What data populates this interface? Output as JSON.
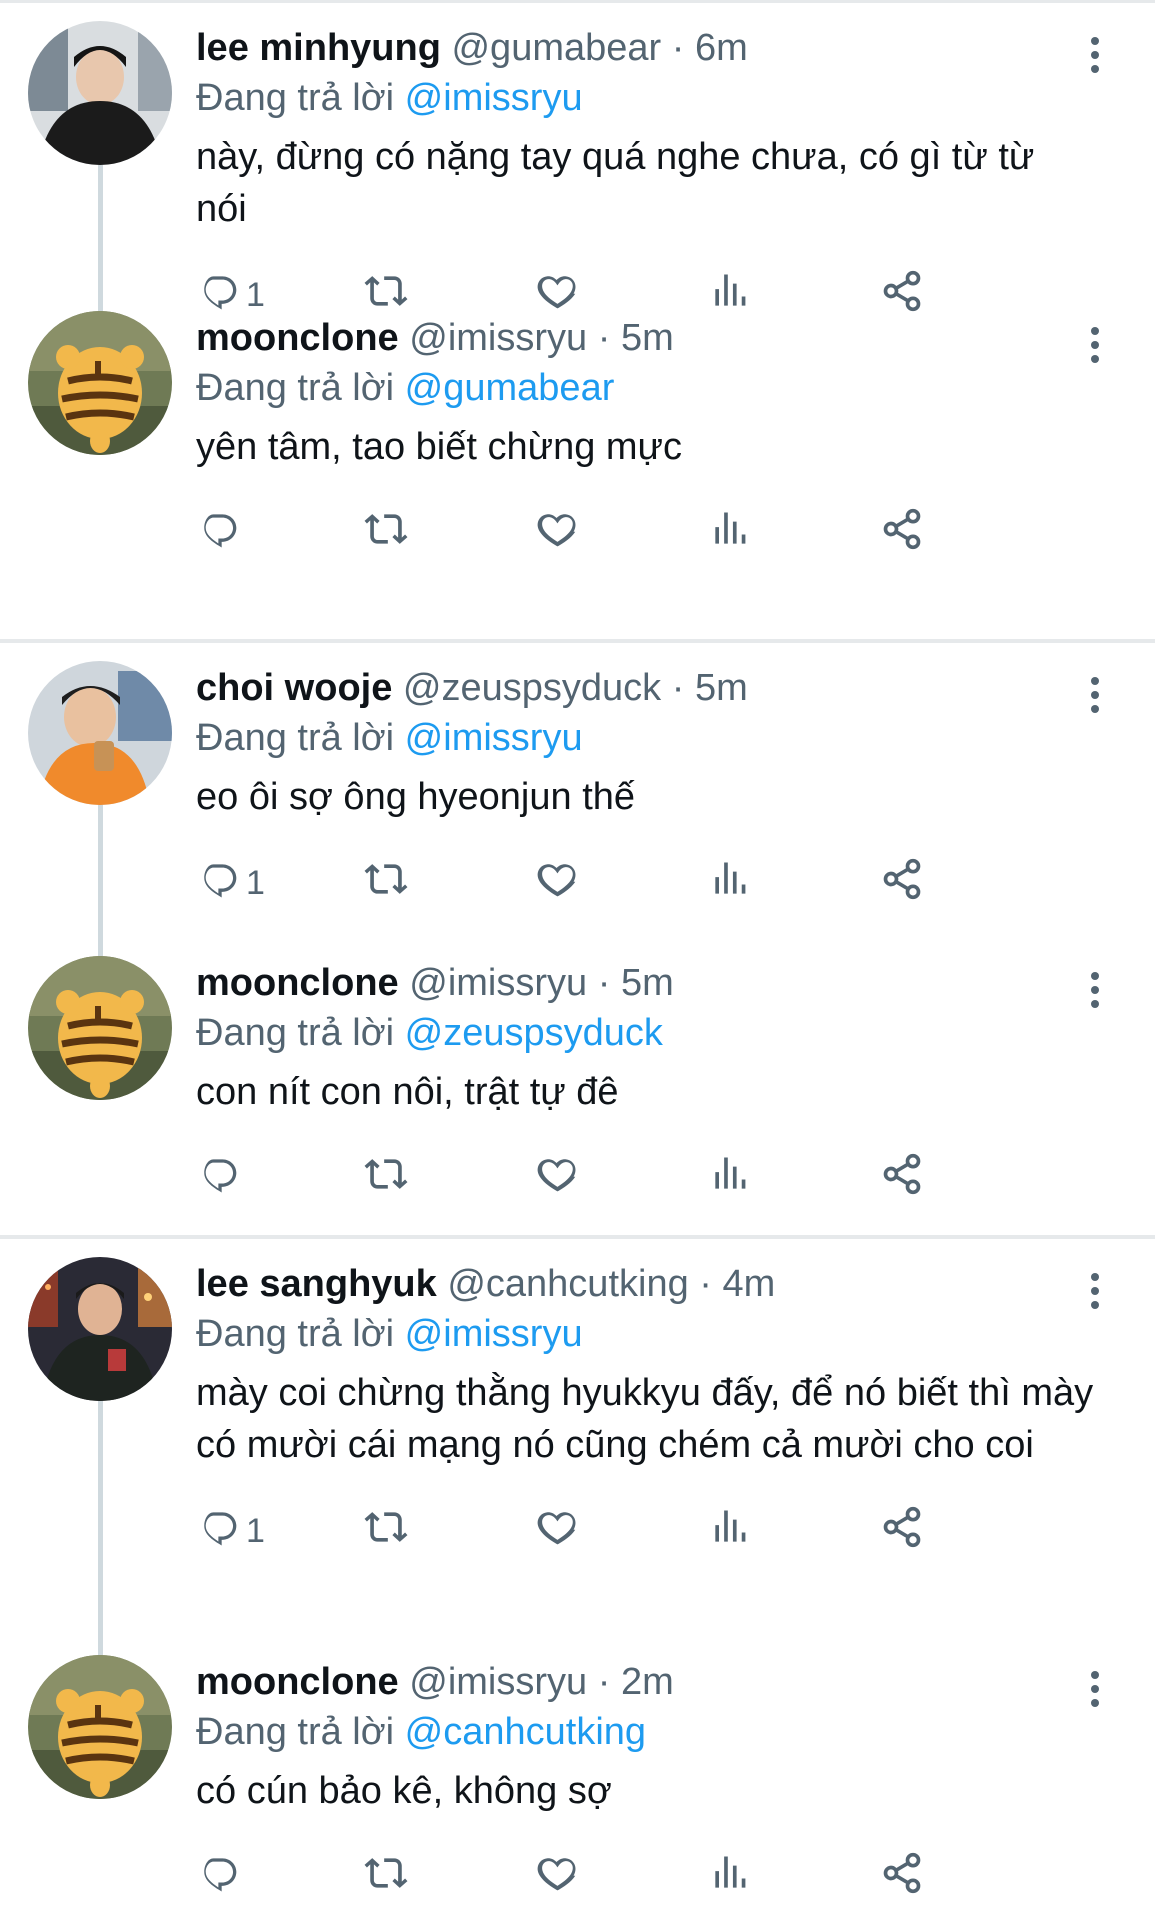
{
  "tweets": [
    {
      "name": "lee minhyung",
      "handle": "@gumabear",
      "dot": "·",
      "time": "6m",
      "reply_prefix": "Đang trả lời",
      "reply_to": "@imissryu",
      "text": "này, đừng có nặng tay quá nghe chưa, có gì từ từ nói",
      "reply_count": "1",
      "avatar": "person-dark"
    },
    {
      "name": "moonclone",
      "handle": "@imissryu",
      "dot": "·",
      "time": "5m",
      "reply_prefix": "Đang trả lời",
      "reply_to": "@gumabear",
      "text": "yên tâm, tao biết chừng mực",
      "reply_count": "",
      "avatar": "tiger"
    },
    {
      "name": "choi wooje",
      "handle": "@zeuspsyduck",
      "dot": "·",
      "time": "5m",
      "reply_prefix": "Đang trả lời",
      "reply_to": "@imissryu",
      "text": "eo ôi sợ ông hyeonjun thế",
      "reply_count": "1",
      "avatar": "person-orange"
    },
    {
      "name": "moonclone",
      "handle": "@imissryu",
      "dot": "·",
      "time": "5m",
      "reply_prefix": "Đang trả lời",
      "reply_to": "@zeuspsyduck",
      "text": "con nít con nôi, trật tự đê",
      "reply_count": "",
      "avatar": "tiger"
    },
    {
      "name": "lee sanghyuk",
      "handle": "@canhcutking",
      "dot": "·",
      "time": "4m",
      "reply_prefix": "Đang trả lời",
      "reply_to": "@imissryu",
      "text": "mày coi chừng thằng hyukkyu đấy, để nó biết thì mày có mười cái mạng nó cũng chém cả mười cho coi",
      "reply_count": "1",
      "avatar": "person-night"
    },
    {
      "name": "moonclone",
      "handle": "@imissryu",
      "dot": "·",
      "time": "2m",
      "reply_prefix": "Đang trả lời",
      "reply_to": "@canhcutking",
      "text": "có cún bảo kê, không sợ",
      "reply_count": "",
      "avatar": "tiger"
    }
  ],
  "icons": {
    "reply": "reply-icon",
    "retweet": "retweet-icon",
    "like": "heart-icon",
    "views": "views-icon",
    "share": "share-icon",
    "more": "more-icon"
  },
  "colors": {
    "link": "#1d9bf0",
    "muted": "#536471",
    "text": "#0f1419",
    "divider": "#e6e9eb"
  }
}
